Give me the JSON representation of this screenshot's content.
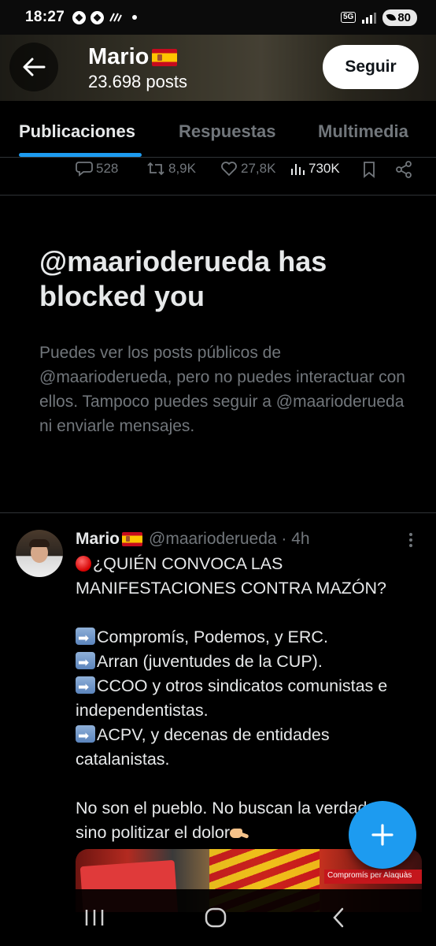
{
  "status_bar": {
    "time": "18:27",
    "network": "5G",
    "battery": "80"
  },
  "header": {
    "name": "Mario",
    "posts": "23.698 posts",
    "follow_label": "Seguir"
  },
  "tabs": [
    {
      "label": "Publicaciones",
      "active": true
    },
    {
      "label": "Respuestas",
      "active": false
    },
    {
      "label": "Multimedia",
      "active": false
    }
  ],
  "prev_tweet_actions": {
    "replies": "528",
    "reposts": "8,9K",
    "likes": "27,8K",
    "views": "730K"
  },
  "blocked_notice": {
    "title": "@maarioderueda has blocked you",
    "body": "Puedes ver los posts públicos de @maarioderueda, pero no puedes interactuar con ellos. Tampoco puedes seguir a @maarioderueda ni enviarle mensajes."
  },
  "tweet": {
    "name": "Mario",
    "handle": "@maarioderueda · 4h",
    "lines": {
      "l1": "¿QUIÉN CONVOCA LAS",
      "l2": "MANIFESTACIONES CONTRA MAZÓN?",
      "l3": "Compromís, Podemos, y ERC.",
      "l4": "Arran (juventudes de la CUP).",
      "l5": "CCOO y otros sindicatos comunistas e",
      "l6": "independentistas.",
      "l7": "ACPV, y decenas de entidades",
      "l8": "catalanistas.",
      "l9": "No son el pueblo. No buscan la verdad,",
      "l10": "sino politizar el dolor"
    },
    "media_label": "Compromís per Alaquàs"
  },
  "colors": {
    "accent": "#1d9bf0",
    "text_primary": "#e7e9ea",
    "text_secondary": "#71767b",
    "divider": "#2f3336"
  }
}
